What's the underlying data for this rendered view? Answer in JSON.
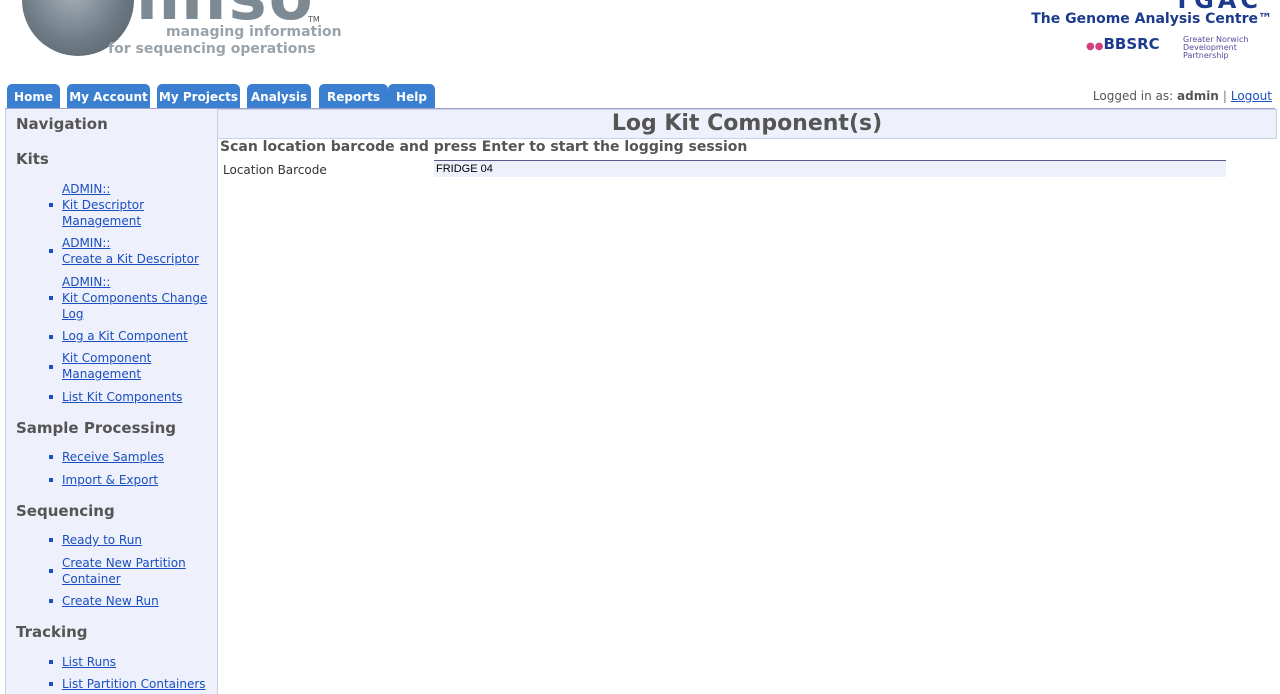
{
  "logo": {
    "word": "miso",
    "tm": "TM",
    "tagline1": "managing information",
    "tagline2": "for sequencing operations"
  },
  "partners": {
    "tgac_short": "TGAC",
    "tgac_name": "The Genome Analysis Centre™",
    "bbsrc": "BBSRC",
    "gndp": "Greater Norwich Development Partnership"
  },
  "tabs": [
    "Home",
    "My Account",
    "My Projects",
    "Analysis",
    "Reports",
    "Help"
  ],
  "login": {
    "prefix": "Logged in as:",
    "user": "admin",
    "separator": "|",
    "logout": "Logout"
  },
  "sidebar": {
    "navigation": "Navigation",
    "kits_heading": "Kits",
    "kits": [
      {
        "line1": "ADMIN::",
        "line2": "Kit Descriptor",
        "line3": "Management"
      },
      {
        "line1": "ADMIN::",
        "line2": "Create a Kit Descriptor"
      },
      {
        "line1": "ADMIN::",
        "line2": "Kit Components Change",
        "line3": "Log"
      },
      {
        "line1": "Log a Kit Component"
      },
      {
        "line1": "Kit Component",
        "line2": "Management"
      },
      {
        "line1": "List Kit Components"
      }
    ],
    "sample_heading": "Sample Processing",
    "sample": [
      "Receive Samples",
      "Import & Export"
    ],
    "seq_heading": "Sequencing",
    "seq": [
      {
        "line1": "Ready to Run"
      },
      {
        "line1": "Create New Partition",
        "line2": "Container"
      },
      {
        "line1": "Create New Run"
      }
    ],
    "tracking_heading": "Tracking",
    "tracking": [
      "List Runs",
      "List Partition Containers"
    ]
  },
  "main": {
    "title": "Log Kit Component(s)",
    "instruction": "Scan location barcode and press Enter to start the logging session",
    "location_label": "Location Barcode",
    "location_value": "FRIDGE 04"
  },
  "colors": {
    "tab_bg": "#3b7fd0",
    "link": "#1a4fbf",
    "panel_bg": "#eef0fb",
    "brand_blue": "#1c3b8c"
  }
}
